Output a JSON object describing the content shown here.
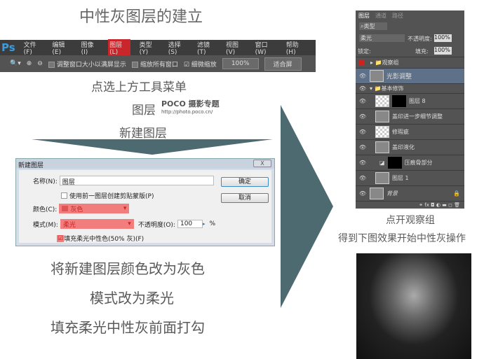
{
  "title": "中性灰图层的建立",
  "menubar": {
    "logo": "Ps",
    "items": [
      "文件(F)",
      "编辑(E)",
      "图像(I)",
      "图层(L)",
      "类型(Y)",
      "选择(S)",
      "滤镜(T)",
      "视图(V)",
      "窗口(W)",
      "帮助(H)"
    ],
    "active_index": 3
  },
  "toolbar": {
    "opt1": "调整窗口大小以满屏显示",
    "opt2": "缩放所有窗口",
    "opt3": "细微缩放",
    "zoom": "100%",
    "fit": "适合屏"
  },
  "captions": {
    "c1": "点选上方工具菜单",
    "c2": "图层",
    "watermark": "POCO 摄影专题",
    "watermark_url": "http://photo.poco.cn/",
    "c3": "新建图层",
    "c4": "将新建图层颜色改为灰色",
    "c5": "模式改为柔光",
    "c6": "填充柔光中性灰前面打勾",
    "c7": "点开观察组",
    "c8": "得到下图效果开始中性灰操作"
  },
  "dialog": {
    "title": "新建图层",
    "close": "X",
    "name_label": "名称(N):",
    "name_value": "图层",
    "clip_label": "使用前一图层创建剪贴蒙版(P)",
    "color_label": "颜色(C):",
    "color_value": "灰色",
    "mode_label": "模式(M):",
    "mode_value": "柔光",
    "opacity_label": "不透明度(O):",
    "opacity_value": "100",
    "percent": "%",
    "fill_label": "填充柔光中性色(50% 灰)(F)",
    "ok": "确定",
    "cancel": "取消"
  },
  "panel": {
    "tabs": [
      "图层",
      "通道",
      "路径"
    ],
    "filter": "类型",
    "blend": "柔光",
    "opacity_label": "不透明度:",
    "opacity": "100%",
    "lock_label": "锁定:",
    "fill_label": "填充:",
    "fill": "100%",
    "layers": [
      "观察组",
      "光影调整",
      "基本修饰",
      "图层 8",
      "盖印进一步细节调整",
      "修瑕疵",
      "盖印液化",
      "压痕骨部分",
      "图层 1",
      "背景"
    ]
  }
}
